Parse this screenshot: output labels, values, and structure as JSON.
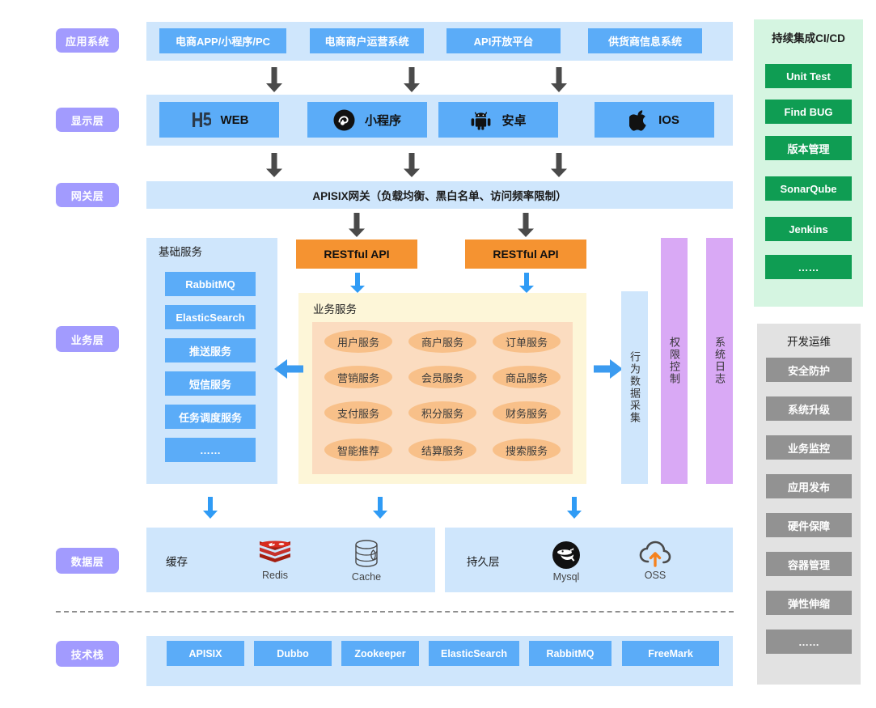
{
  "layers": {
    "application": "应用系统",
    "presentation": "显示层",
    "gateway": "网关层",
    "business": "业务层",
    "data": "数据层",
    "techstack": "技术栈"
  },
  "application_systems": [
    "电商APP/小程序/PC",
    "电商商户运营系统",
    "API开放平台",
    "供货商信息系统"
  ],
  "presentation": [
    {
      "label": "WEB",
      "icon": "h5-icon"
    },
    {
      "label": "小程序",
      "icon": "wechat-miniprogram-icon"
    },
    {
      "label": "安卓",
      "icon": "android-icon"
    },
    {
      "label": "IOS",
      "icon": "apple-icon"
    }
  ],
  "gateway": {
    "text": "APISIX网关（负载均衡、黑白名单、访问频率限制）"
  },
  "basic_services": {
    "title": "基础服务",
    "items": [
      "RabbitMQ",
      "ElasticSearch",
      "推送服务",
      "短信服务",
      "任务调度服务",
      "……"
    ]
  },
  "restful_api": {
    "left": "RESTful API",
    "right": "RESTful API"
  },
  "business_services": {
    "title": "业务服务",
    "items": [
      "用户服务",
      "商户服务",
      "订单服务",
      "营销服务",
      "会员服务",
      "商品服务",
      "支付服务",
      "积分服务",
      "财务服务",
      "智能推荐",
      "结算服务",
      "搜索服务"
    ]
  },
  "vertical_bars": [
    {
      "label": "行为数据采集",
      "color": "#cfe6fc"
    },
    {
      "label": "权限控制",
      "color": "#d9a9f5"
    },
    {
      "label": "系统日志",
      "color": "#d9a9f5"
    }
  ],
  "data_layer": {
    "cache": {
      "title": "缓存",
      "items": [
        {
          "label": "Redis",
          "icon": "redis-icon"
        },
        {
          "label": "Cache",
          "icon": "database-cylinder-icon"
        }
      ]
    },
    "persistence": {
      "title": "持久层",
      "items": [
        {
          "label": "Mysql",
          "icon": "mysql-dolphin-icon"
        },
        {
          "label": "OSS",
          "icon": "oss-cloud-icon"
        }
      ]
    }
  },
  "tech_stack": [
    "APISIX",
    "Dubbo",
    "Zookeeper",
    "ElasticSearch",
    "RabbitMQ",
    "FreeMark"
  ],
  "cicd": {
    "title": "持续集成CI/CD",
    "items": [
      "Unit Test",
      "Find BUG",
      "版本管理",
      "SonarQube",
      "Jenkins",
      "……"
    ]
  },
  "devops": {
    "title": "开发运维",
    "items": [
      "安全防护",
      "系统升级",
      "业务监控",
      "应用发布",
      "硬件保障",
      "容器管理",
      "弹性伸缩",
      "……"
    ]
  },
  "colors": {
    "layer_pill": "#a29bfe",
    "band": "#cfe6fc",
    "chip": "#5bacf8",
    "restful": "#f59331",
    "biz_panel": "#fdf6d8",
    "biz_pill": "#f8c089",
    "cicd": "#0f9d53",
    "devops": "#929292",
    "purple_bar": "#d9a9f5",
    "arrow_dark": "#4a4a4a",
    "arrow_blue": "#2f9bf5"
  }
}
